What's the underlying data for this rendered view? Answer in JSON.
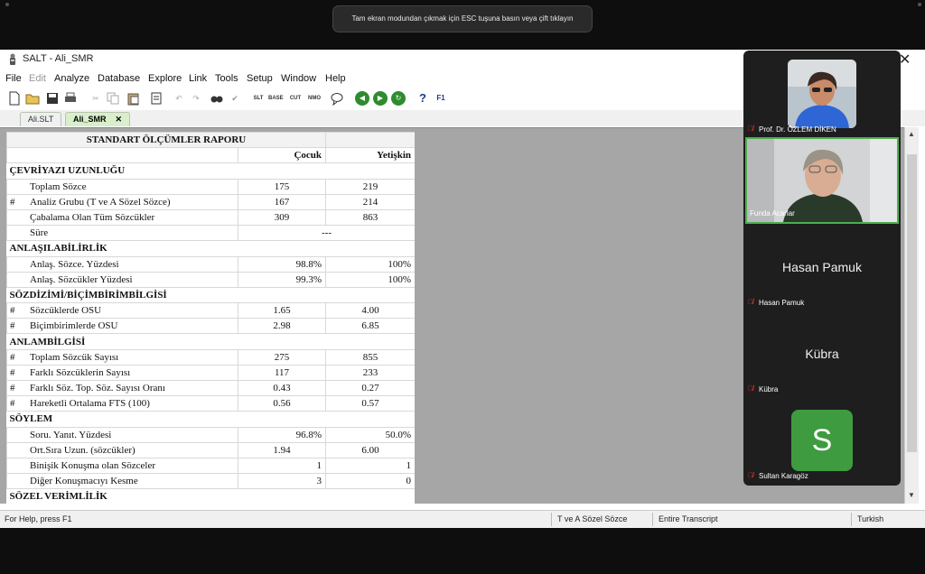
{
  "toast": {
    "text": "Tam ekran modundan çıkmak için ESC tuşuna basın veya çift tıklayın"
  },
  "window": {
    "title": "SALT - Ali_SMR",
    "close_glyph": "✕"
  },
  "menu": [
    {
      "label": "File",
      "disabled": false
    },
    {
      "label": "Edit",
      "disabled": true
    },
    {
      "label": "Analyze",
      "disabled": false
    },
    {
      "label": "Database",
      "disabled": false
    },
    {
      "label": "Explore",
      "disabled": false
    },
    {
      "label": "Link",
      "disabled": false
    },
    {
      "label": "Tools",
      "disabled": false
    },
    {
      "label": "Setup",
      "disabled": false
    },
    {
      "label": "Window",
      "disabled": false
    },
    {
      "label": "Help",
      "disabled": false
    }
  ],
  "toolbar": {
    "icons": [
      "new-file-icon",
      "open-folder-icon",
      "save-icon",
      "print-icon",
      "cut-icon",
      "copy-icon",
      "paste-icon",
      "undo-icon",
      "redo-icon",
      "find-icon",
      "check-icon",
      "slt-icon",
      "base-icon",
      "cut-text-icon",
      "nmo-icon",
      "speech-icon",
      "back-icon",
      "forward-icon",
      "refresh-icon",
      "help-icon",
      "f1-help-icon"
    ],
    "labels": {
      "slt": "SLT",
      "base": "BASE",
      "cut": "CUT",
      "nmo": "NMO",
      "help": "?",
      "f1": "F1"
    },
    "colors": {
      "green": "#2e8b2e",
      "blue_text": "#1f3a8a"
    }
  },
  "tabs": [
    {
      "label": "Ali.SLT",
      "active": false
    },
    {
      "label": "Ali_SMR",
      "active": true,
      "close": "✕"
    }
  ],
  "report": {
    "title": "STANDART ÖLÇÜMLER RAPORU",
    "col_child": "Çocuk",
    "col_adult": "Yetişkin",
    "rows": [
      {
        "type": "section",
        "label": "ÇEVRİYAZI UZUNLUĞU"
      },
      {
        "type": "row",
        "mark": "",
        "label": "Toplam Sözce",
        "child": "175",
        "adult": "219"
      },
      {
        "type": "row",
        "mark": "#",
        "label": "Analiz Grubu (T ve A Sözel Sözce)",
        "child": "167",
        "adult": "214"
      },
      {
        "type": "row",
        "mark": "",
        "label": "Çabalama Olan Tüm Sözcükler",
        "child": "309",
        "adult": "863"
      },
      {
        "type": "span",
        "mark": "",
        "label": "Süre",
        "value": "---"
      },
      {
        "type": "section",
        "label": "ANLAŞILABİLİRLİK"
      },
      {
        "type": "row",
        "mark": "",
        "label": "Anlaş. Sözce. Yüzdesi",
        "child": "98.8%",
        "adult": "100%",
        "pct": true
      },
      {
        "type": "row",
        "mark": "",
        "label": "Anlaş. Sözcükler Yüzdesi",
        "child": "99.3%",
        "adult": "100%",
        "pct": true
      },
      {
        "type": "section",
        "label": "SÖZDİZİMİ/BİÇİMBİRİMBİLGİSİ"
      },
      {
        "type": "row",
        "mark": "#",
        "label": "Sözcüklerde OSU",
        "child": "1.65",
        "adult": "4.00"
      },
      {
        "type": "row",
        "mark": "#",
        "label": "Biçimbirimlerde OSU",
        "child": "2.98",
        "adult": "6.85"
      },
      {
        "type": "section",
        "label": "ANLAMBİLGİSİ"
      },
      {
        "type": "row",
        "mark": "#",
        "label": "Toplam Sözcük Sayısı",
        "child": "275",
        "adult": "855"
      },
      {
        "type": "row",
        "mark": "#",
        "label": "Farklı Sözcüklerin Sayısı",
        "child": "117",
        "adult": "233"
      },
      {
        "type": "row",
        "mark": "#",
        "label": "Farklı Söz. Top. Söz. Sayısı Oranı",
        "child": "0.43",
        "adult": "0.27"
      },
      {
        "type": "row",
        "mark": "#",
        "label": "Hareketli Ortalama FTS (100)",
        "child": "0.56",
        "adult": "0.57"
      },
      {
        "type": "section",
        "label": "SÖYLEM"
      },
      {
        "type": "row",
        "mark": "",
        "label": "Soru. Yanıt. Yüzdesi",
        "child": "96.8%",
        "adult": "50.0%",
        "pct": true
      },
      {
        "type": "row",
        "mark": "",
        "label": "Ort.Sıra Uzun. (sözcükler)",
        "child": "1.94",
        "adult": "6.00"
      },
      {
        "type": "row",
        "mark": "",
        "label": "Binişik Konuşma olan Sözceler",
        "child": "1",
        "adult": "1",
        "right": true
      },
      {
        "type": "row",
        "mark": "",
        "label": "Diğer Konuşmacıyı Kesme",
        "child": "3",
        "adult": "0",
        "right": true
      },
      {
        "type": "section",
        "label": "SÖZEL VERİMLİLİK"
      }
    ]
  },
  "status": {
    "help": "For Help, press F1",
    "group": "T ve A Sözel Sözce",
    "scope": "Entire Transcript",
    "language": "Turkish"
  },
  "participants": [
    {
      "name": "Prof. Dr. ÖZLEM DİKEN",
      "muted": true,
      "video": true
    },
    {
      "name": "Funda Acarlar",
      "muted": false,
      "video": true,
      "speaking": true
    },
    {
      "name": "Hasan Pamuk",
      "muted": true,
      "video": false
    },
    {
      "name": "Kübra",
      "muted": true,
      "video": false
    },
    {
      "name": "Sultan Karagöz",
      "muted": true,
      "video": false,
      "initial": "S",
      "avatar_color": "#3f9b3f"
    }
  ]
}
